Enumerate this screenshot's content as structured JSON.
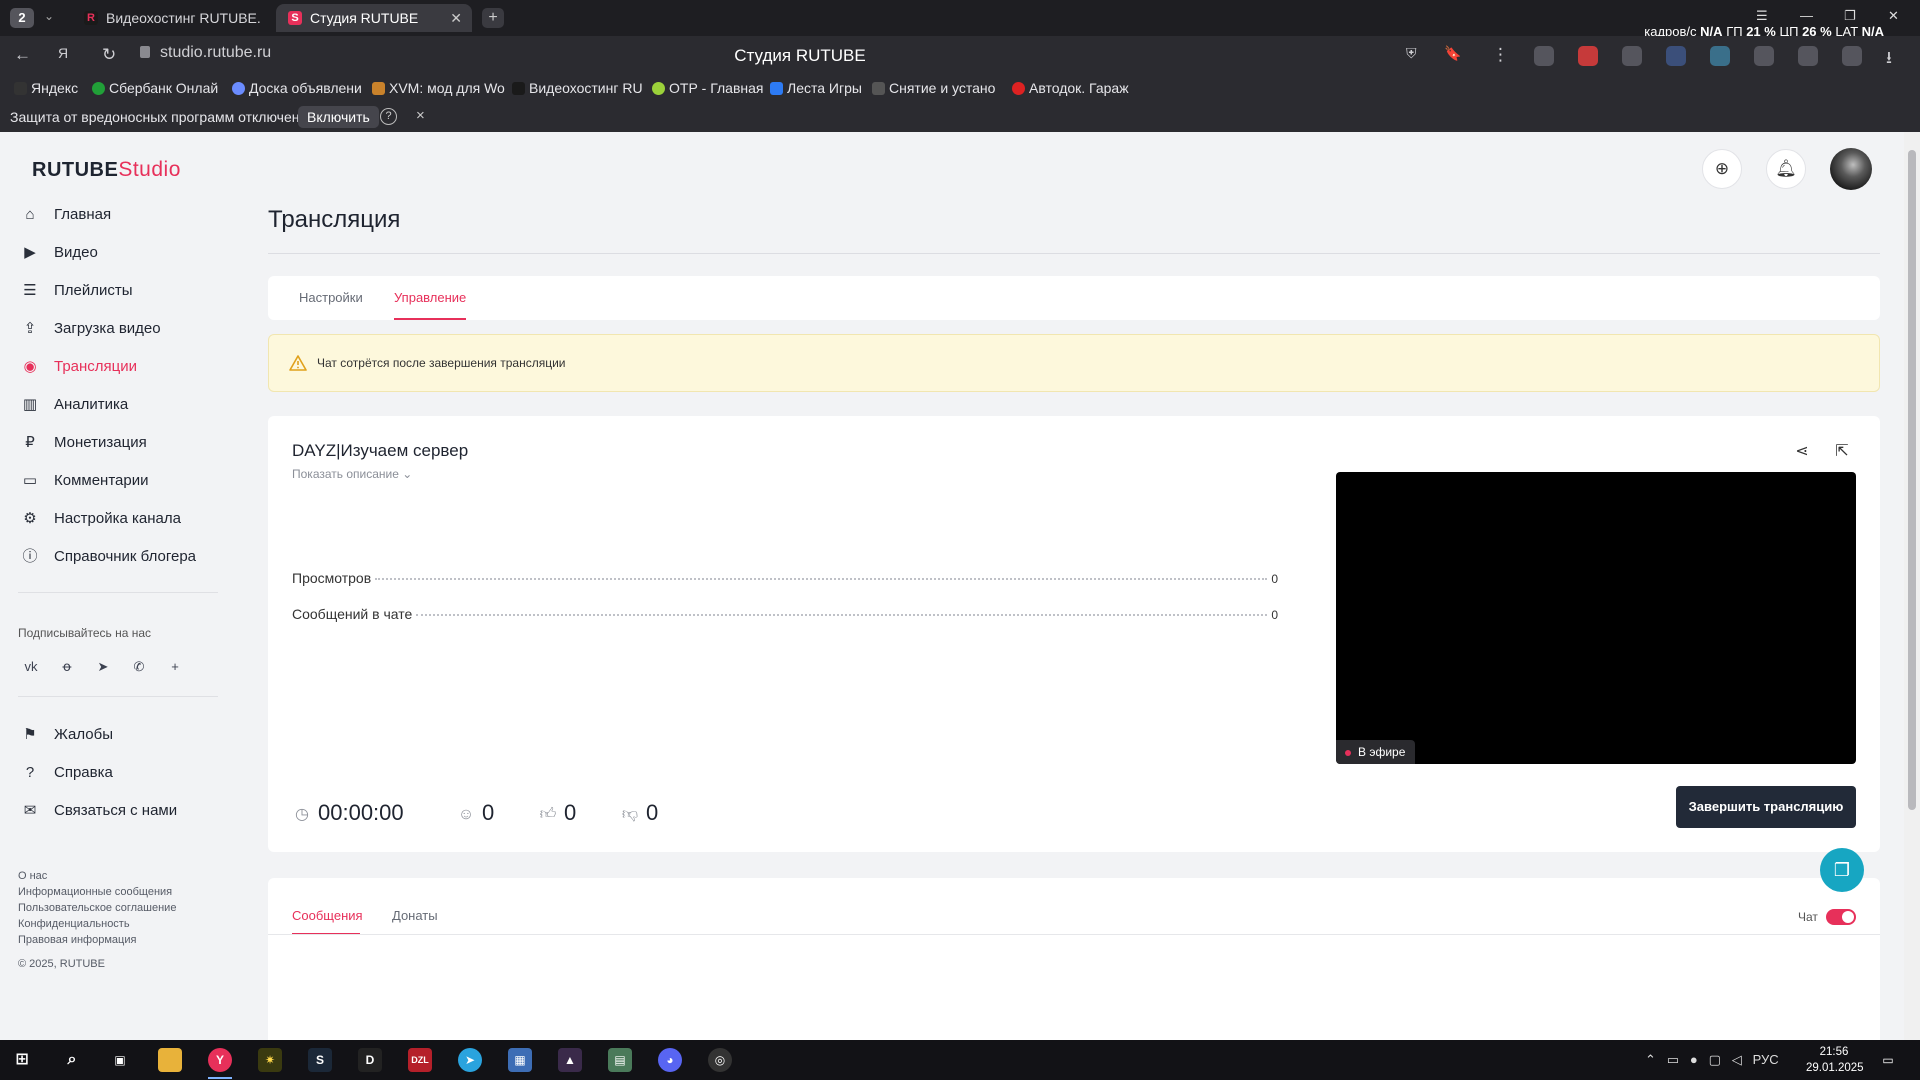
{
  "browser": {
    "tab_count": "2",
    "tabs": [
      {
        "label": "Видеохостинг RUTUBE. С",
        "favicon": "R"
      },
      {
        "label": "Студия RUTUBE",
        "favicon": "S"
      }
    ],
    "url": "studio.rutube.ru",
    "page_title": "Студия RUTUBE",
    "sysstats": {
      "prefix": "кадров/с",
      "fps": "N/A",
      "gpu_label": "ГП",
      "gpu": "21 %",
      "cpu_label": "ЦП",
      "cpu": "26 %",
      "lat_label": "LAT",
      "lat": "N/A"
    },
    "bookmarks": [
      "Яндекс",
      "Сбербанк Онлай",
      "Доска объявлени",
      "XVM: мод для Wo",
      "Видеохостинг RU",
      "ОТР - Главная",
      "Леста Игры",
      "Снятие и устано",
      "Автодок. Гараж"
    ],
    "warning": {
      "text": "Защита от вредоносных программ отключена",
      "enable": "Включить",
      "help": "?",
      "close": "×"
    }
  },
  "sidebar": {
    "logo_main": "RUTUBE",
    "logo_studio": "Studio",
    "nav": [
      {
        "label": "Главная",
        "icon": "home-icon"
      },
      {
        "label": "Видео",
        "icon": "video-icon"
      },
      {
        "label": "Плейлисты",
        "icon": "playlist-icon"
      },
      {
        "label": "Загрузка видео",
        "icon": "upload-icon"
      },
      {
        "label": "Трансляции",
        "icon": "broadcast-icon"
      },
      {
        "label": "Аналитика",
        "icon": "analytics-icon"
      },
      {
        "label": "Монетизация",
        "icon": "monetization-icon"
      },
      {
        "label": "Комментарии",
        "icon": "comments-icon"
      },
      {
        "label": "Настройка канала",
        "icon": "settings-icon"
      },
      {
        "label": "Справочник блогера",
        "icon": "guide-icon"
      }
    ],
    "active_index": 4,
    "follow_label": "Подписывайтесь на нас",
    "socials": [
      "vk-icon",
      "ok-icon",
      "telegram-icon",
      "viber-icon",
      "plus-icon"
    ],
    "support_nav": [
      {
        "label": "Жалобы",
        "icon": "flag-icon"
      },
      {
        "label": "Справка",
        "icon": "help-icon"
      },
      {
        "label": "Связаться с нами",
        "icon": "mail-icon"
      }
    ],
    "footer_links": [
      "О нас",
      "Информационные сообщения",
      "Пользовательское соглашение",
      "Конфиденциальность",
      "Правовая информация",
      "© 2025, RUTUBE"
    ]
  },
  "main": {
    "title": "Трансляция",
    "tabs": [
      "Настройки",
      "Управление"
    ],
    "active_tab": 1,
    "notice": "Чат сотрётся после завершения трансляции",
    "stream": {
      "title": "DAYZ|Изучаем сервер",
      "show_description": "Показать описание",
      "stats": [
        {
          "label": "Просмотров",
          "value": "0"
        },
        {
          "label": "Сообщений в чате",
          "value": "0"
        }
      ],
      "live_label": "В эфире",
      "duration": "00:00:00",
      "viewers": "0",
      "likes": "0",
      "dislikes": "0",
      "end_button": "Завершить трансляцию"
    },
    "chat": {
      "tabs": [
        "Сообщения",
        "Донаты"
      ],
      "active_tab": 0,
      "toggle_label": "Чат",
      "toggle_on": true
    }
  },
  "colors": {
    "accent": "#e7305a",
    "dark_button": "#222a38",
    "notice_bg": "#fdf8dc",
    "support": "#17a6c2"
  },
  "taskbar": {
    "language": "РУС",
    "time": "21:56",
    "date": "29.01.2025"
  }
}
